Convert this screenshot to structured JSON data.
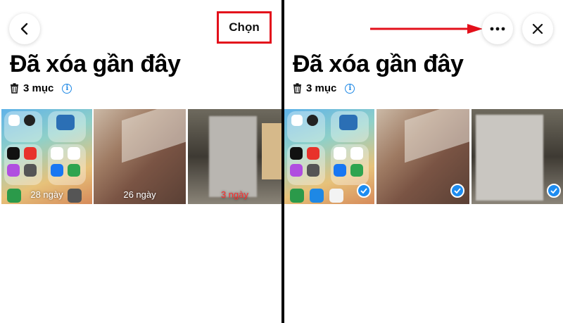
{
  "left": {
    "title": "Đã xóa gần đây",
    "count_label": "3 mục",
    "select_label": "Chọn",
    "thumbnails": [
      {
        "days": "28 ngày"
      },
      {
        "days": "26 ngày"
      },
      {
        "days": "3 ngày"
      }
    ]
  },
  "right": {
    "title": "Đã xóa gần đây",
    "count_label": "3 mục"
  },
  "colors": {
    "highlight_box": "#e3101b",
    "arrow": "#e3101b",
    "check": "#1d8cf0",
    "info": "#1e88e5"
  }
}
